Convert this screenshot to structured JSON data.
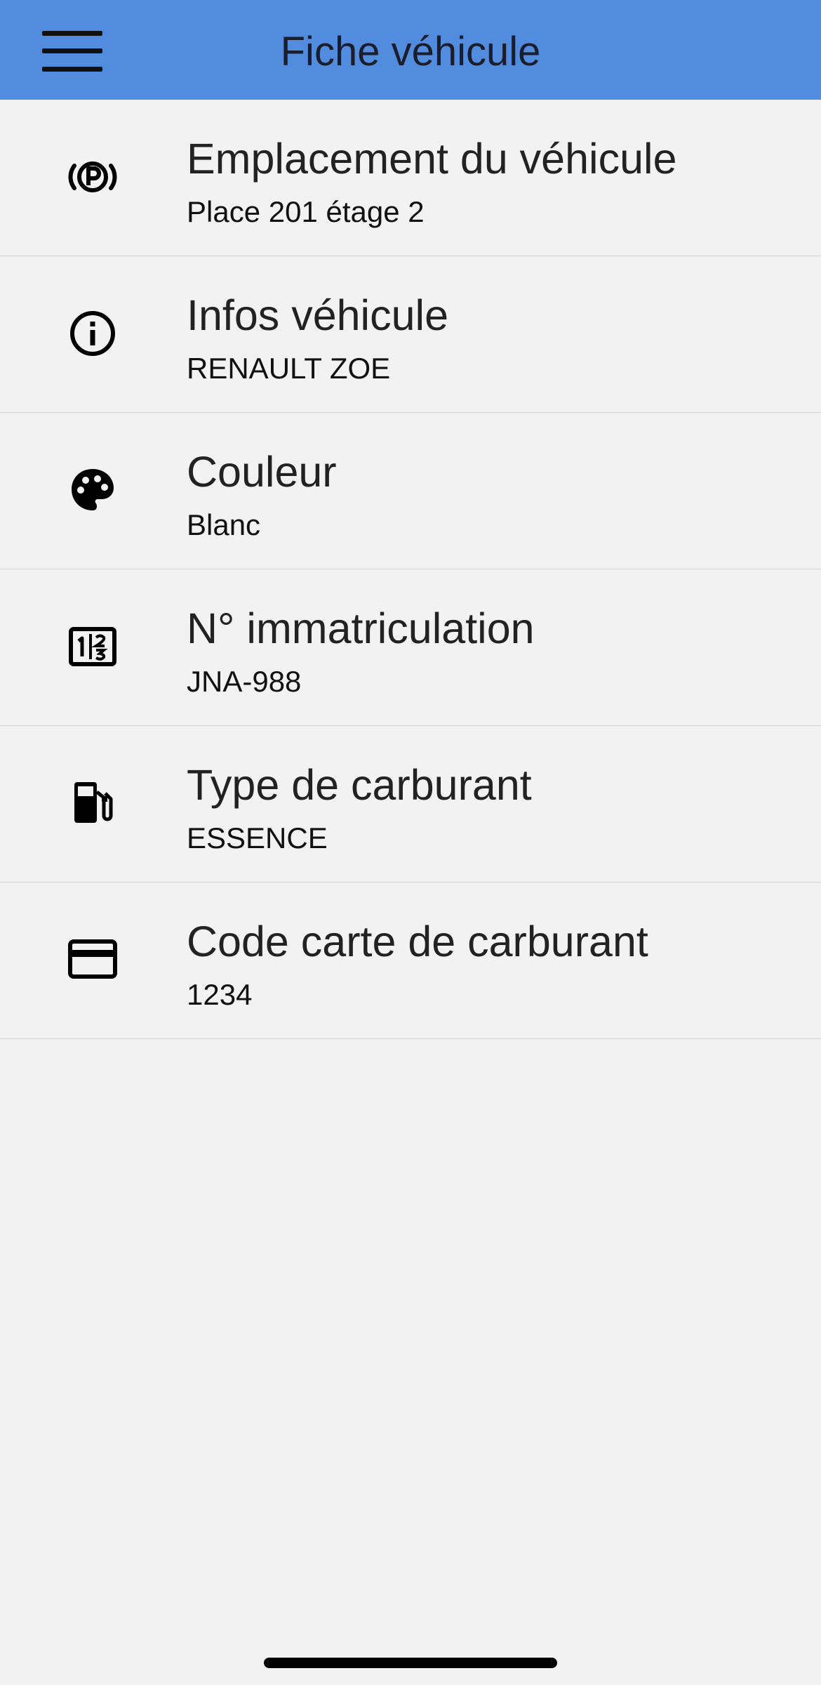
{
  "header": {
    "title": "Fiche véhicule",
    "menu_icon": "hamburger-menu-icon",
    "background_color": "#528cdf"
  },
  "items": [
    {
      "icon": "parking-icon",
      "title": "Emplacement du véhicule",
      "value": "Place 201 étage 2"
    },
    {
      "icon": "info-icon",
      "title": "Infos véhicule",
      "value": "RENAULT ZOE"
    },
    {
      "icon": "palette-icon",
      "title": "Couleur",
      "value": "Blanc"
    },
    {
      "icon": "license-plate-icon",
      "title": "N° immatriculation",
      "value": "JNA-988"
    },
    {
      "icon": "fuel-pump-icon",
      "title": "Type de carburant",
      "value": "ESSENCE"
    },
    {
      "icon": "credit-card-icon",
      "title": "Code carte de carburant",
      "value": "1234"
    }
  ]
}
